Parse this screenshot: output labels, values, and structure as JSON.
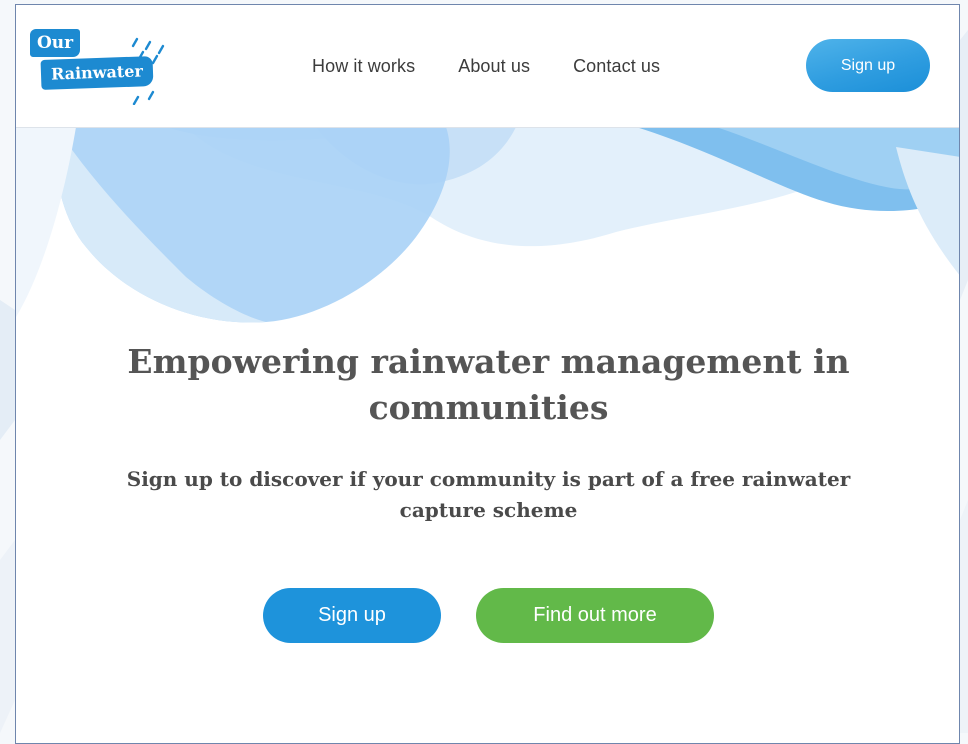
{
  "logo": {
    "line1": "Our",
    "line2": "Rainwater"
  },
  "nav": {
    "links": [
      {
        "label": "How it works"
      },
      {
        "label": "About us"
      },
      {
        "label": "Contact us"
      }
    ],
    "signup_label": "Sign up"
  },
  "hero": {
    "title": "Empowering rainwater management in communities",
    "subtitle": "Sign up to discover if your community is part of a free rainwater capture scheme",
    "primary_button": "Sign up",
    "secondary_button": "Find out more"
  },
  "colors": {
    "brand_blue": "#1d8ad1",
    "primary_button": "#1e93db",
    "secondary_button": "#62b949",
    "heading": "#555555"
  }
}
